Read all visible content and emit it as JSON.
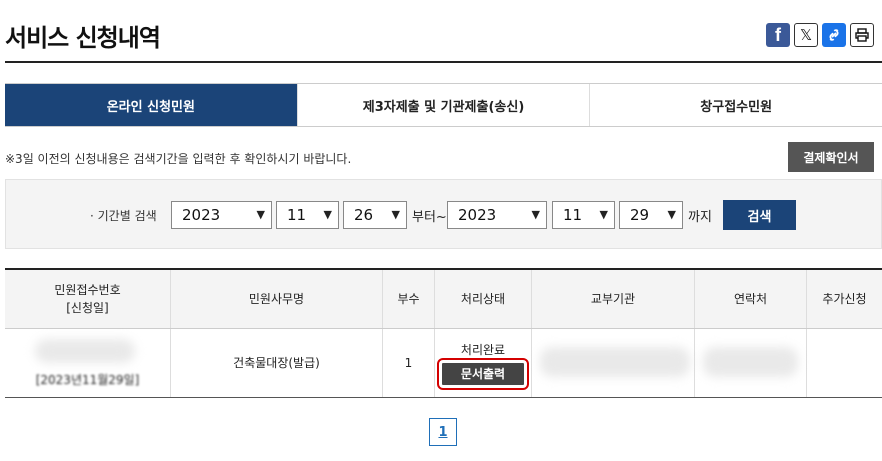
{
  "page": {
    "title": "서비스 신청내역"
  },
  "share": {
    "facebook": "f",
    "x": "𝕏",
    "link": "🔗",
    "print": "⎙"
  },
  "tabs": [
    {
      "label": "온라인 신청민원"
    },
    {
      "label": "제3자제출 및 기관제출(송신)"
    },
    {
      "label": "창구접수민원"
    }
  ],
  "notice": "※3일 이전의 신청내용은 검색기간을 입력한 후 확인하시기 바랍니다.",
  "payment_button": "결제확인서",
  "search": {
    "label": "· 기간별 검색",
    "from": {
      "year": "2023",
      "month": "11",
      "day": "26"
    },
    "from_suffix": "부터~",
    "to": {
      "year": "2023",
      "month": "11",
      "day": "29"
    },
    "to_suffix": "까지",
    "button": "검색"
  },
  "table": {
    "headers": [
      "민원접수번호",
      "[신청일]",
      "민원사무명",
      "부수",
      "처리상태",
      "교부기관",
      "연락처",
      "추가신청"
    ],
    "row": {
      "date": "[2023년11월29일]",
      "service": "건축물대장(발급)",
      "copies": "1",
      "status": "처리완료",
      "print_button": "문서출력"
    }
  },
  "pagination": {
    "current": "1"
  }
}
